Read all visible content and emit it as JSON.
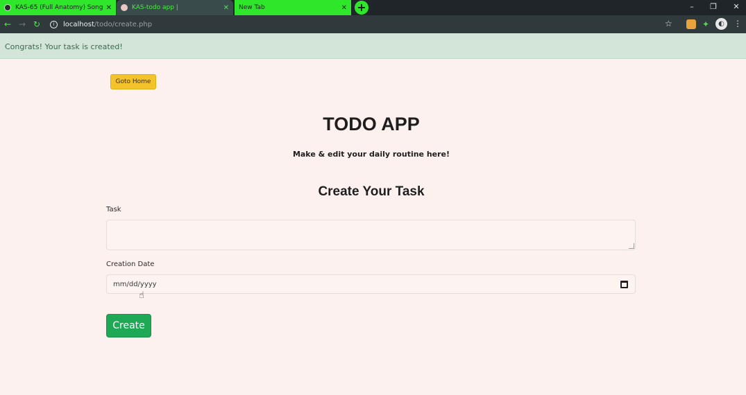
{
  "browser": {
    "tabs": [
      {
        "title": "KAS-65 (Full Anatomy) Songs...",
        "active": false
      },
      {
        "title": "KAS-todo app |",
        "active": true
      },
      {
        "title": "New Tab",
        "active": false
      }
    ],
    "new_tab_icon": "+",
    "window_controls": {
      "minimize": "–",
      "restore": "❐",
      "close": "✕"
    },
    "url_host": "localhost",
    "url_path": "/todo/create.php",
    "icons": {
      "back": "←",
      "forward": "→",
      "reload": "↻",
      "star": "☆",
      "puzzle": "✦",
      "profile": "◐",
      "menu": "⋮",
      "info": "i"
    },
    "colors": {
      "tab_green": "#2ee62a",
      "chrome_dark": "#1f2528"
    }
  },
  "alert": {
    "message": "Congrats! Your task is created!"
  },
  "home_button": {
    "label": "Goto Home"
  },
  "header": {
    "title": "TODO APP",
    "subtitle": "Make & edit your daily routine here!"
  },
  "form": {
    "section_title": "Create Your Task",
    "task_label": "Task",
    "task_value": "",
    "date_label": "Creation Date",
    "date_placeholder": "mm/dd/yyyy",
    "submit_label": "Create"
  },
  "colors": {
    "page_bg": "#fdf1ef",
    "alert_bg": "#d3e5d9",
    "home_button_bg": "#f4c22b",
    "create_button_bg": "#1fa855"
  }
}
